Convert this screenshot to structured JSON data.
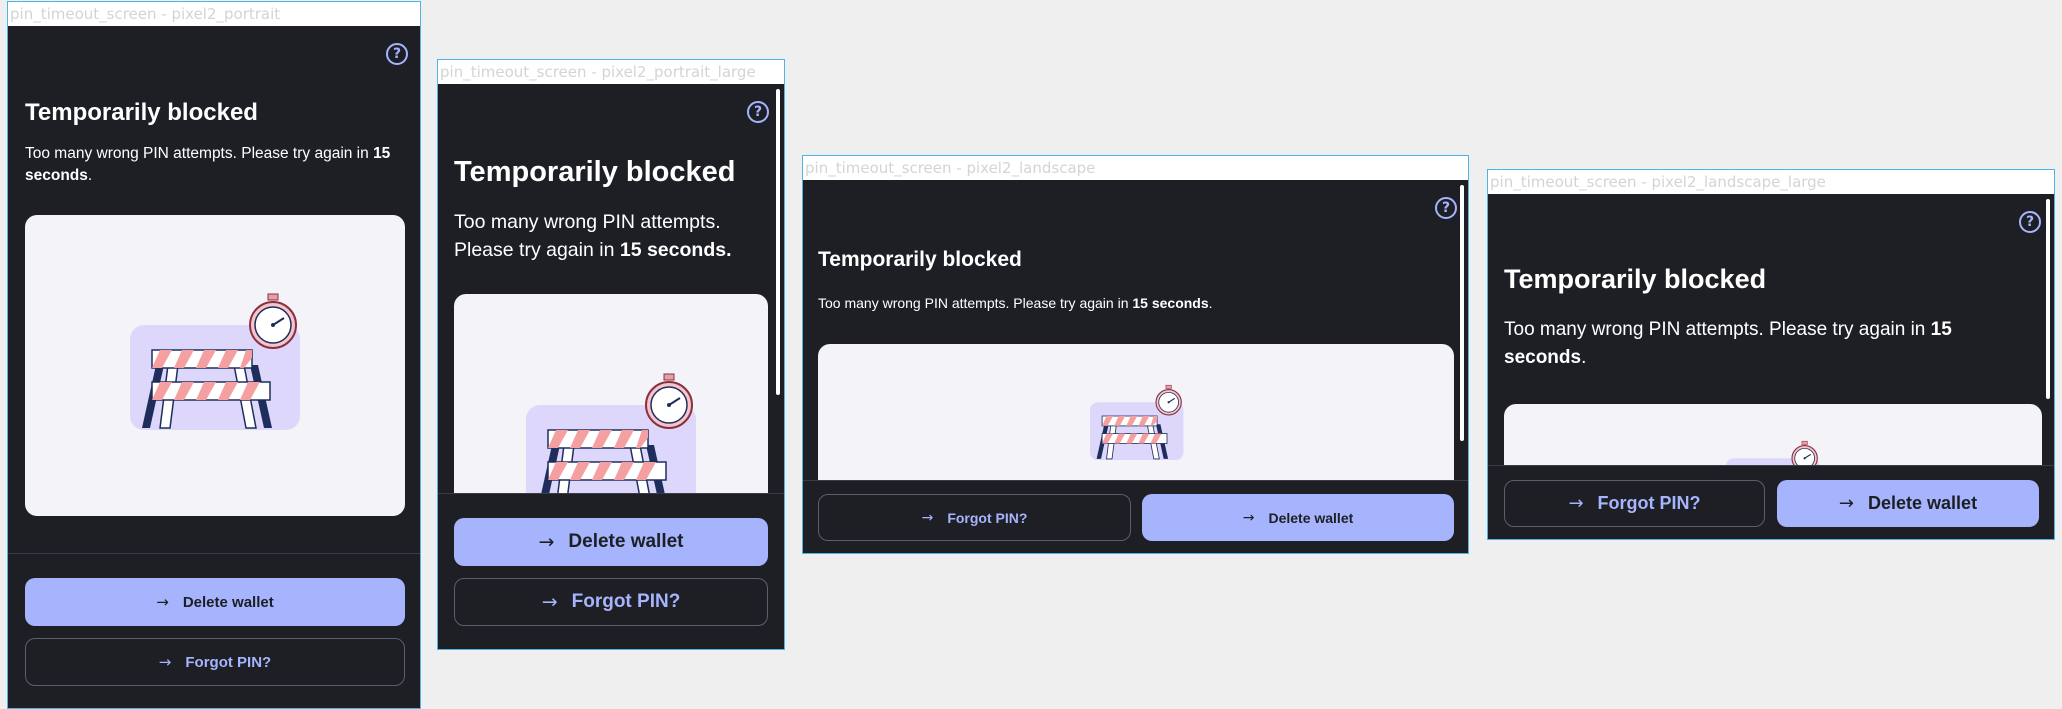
{
  "frames": [
    "pin_timeout_screen - pixel2_portrait",
    "pin_timeout_screen - pixel2_portrait_large",
    "pin_timeout_screen - pixel2_landscape",
    "pin_timeout_screen - pixel2_landscape_large"
  ],
  "screen": {
    "help_icon": "question-circle-icon",
    "title": "Temporarily blocked",
    "message_prefix": "Too many wrong PIN attempts. Please try again in",
    "message_time": "15 seconds",
    "message_suffix": ".",
    "message_prefix_short": "Too many wrong PIN attempts.",
    "message_prefix_rest": "Please try again in",
    "delete_wallet": "Delete wallet",
    "forgot_pin": "Forgot PIN?",
    "arrow_icon": "→"
  },
  "colors": {
    "background": "#1d1f24",
    "primary_button": "#a5b4fc",
    "illustration_bg": "#f4f3f8",
    "barrier_stripe": "#f4a0a0",
    "barrier_leg": "#1f2d5c"
  }
}
